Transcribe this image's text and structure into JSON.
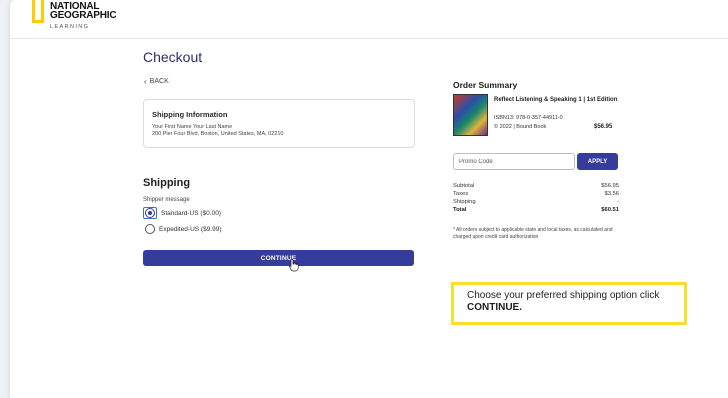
{
  "brand": {
    "line1": "NATIONAL",
    "line2": "GEOGRAPHIC",
    "sub": "LEARNING",
    "accent_color": "#ffcc00"
  },
  "page": {
    "title": "Checkout",
    "back_label": "BACK",
    "back_icon": "chevron-left-icon"
  },
  "shipping_info": {
    "title": "Shipping Information",
    "name": "Your First Name Your Last Name",
    "address": "200 Pier Four Blvd, Boston, United States, MA, 02210"
  },
  "shipping": {
    "heading": "Shipping",
    "shipper_label": "Shipper message",
    "options": [
      {
        "label": "Standard-US ($0.00)",
        "selected": true
      },
      {
        "label": "Expedited-US ($9.99)",
        "selected": false
      }
    ],
    "continue_label": "CONTINUE"
  },
  "order_summary": {
    "title": "Order Summary",
    "book": {
      "title": "Reflect Listening & Speaking 1 | 1st Edition",
      "isbn": "ISBN13: 978-0-357-44911-0",
      "meta": "© 2022 | Bound Book",
      "price": "$56.95"
    },
    "promo_placeholder": "Promo Code",
    "apply_label": "APPLY",
    "rows": [
      {
        "label": "Subtotal",
        "value": "$56.95"
      },
      {
        "label": "Taxes",
        "value": "$3.56"
      },
      {
        "label": "Shipping",
        "value": "-"
      },
      {
        "label": "Total",
        "value": "$60.51"
      }
    ],
    "footnote": "* All orders subject to applicable state and local taxes, as calculated and charged upon credit card authorization"
  },
  "callout": {
    "text": "Choose your preferred shipping option click",
    "emphasis": "CONTINUE."
  },
  "colors": {
    "primary_button": "#353c99",
    "title_color": "#2b2f6b",
    "callout_border": "#f5e12b"
  }
}
